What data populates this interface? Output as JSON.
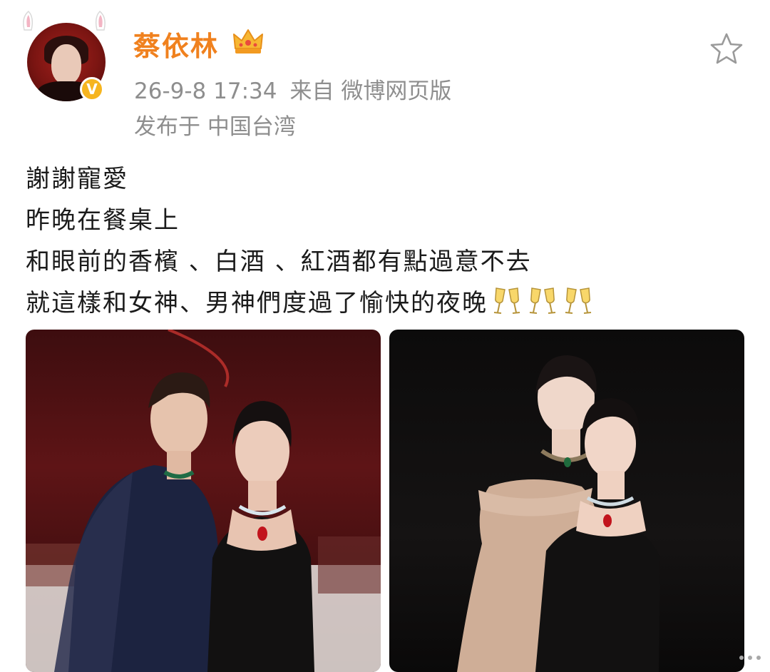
{
  "post": {
    "author": {
      "username": "蔡依林",
      "avatar_icon": "avatar-bunny-ears",
      "verified_icon": "verified-v-badge",
      "verified_mark": "V",
      "rank_icon": "crown-icon"
    },
    "meta": {
      "timestamp": "26-9-8 17:34",
      "source": "来自 微博网页版",
      "location": "发布于 中国台湾"
    },
    "favorite_icon": "star-outline-icon",
    "content": {
      "lines": [
        "謝謝寵愛",
        "昨晚在餐桌上",
        "和眼前的香檳 、白酒 、紅酒都有點過意不去",
        "就這樣和女神、男神們度過了愉快的夜晚"
      ],
      "emoji_icons": [
        "clinking-glasses-icon",
        "clinking-glasses-icon",
        "clinking-glasses-icon"
      ]
    },
    "images": [
      {
        "name": "photo-two-women-banquet"
      },
      {
        "name": "photo-two-women-dark-backdrop"
      }
    ],
    "colors": {
      "username": "#f0811e",
      "meta_text": "#8e8e8e",
      "body_text": "#1b1b1b",
      "verified_badge": "#f6b51f"
    }
  }
}
